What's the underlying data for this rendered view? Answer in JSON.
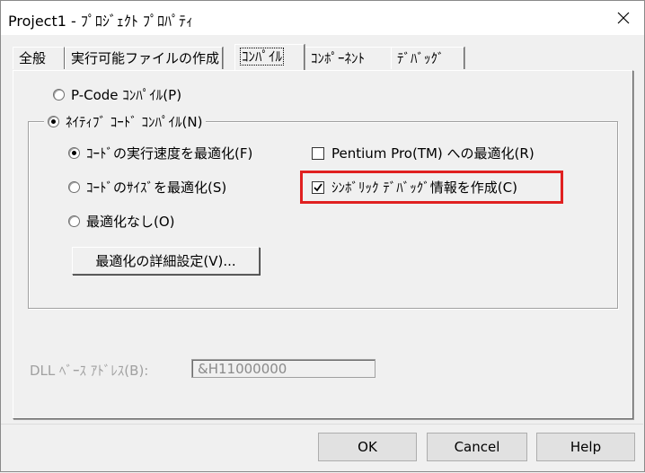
{
  "window": {
    "title": "Project1 - ﾌﾟﾛｼﾞｪｸﾄ ﾌﾟﾛﾊﾟﾃｨ",
    "close_icon": "close-icon"
  },
  "tabs": [
    {
      "label": "全般",
      "active": false
    },
    {
      "label": "実行可能ファイルの作成",
      "active": false
    },
    {
      "label": "ｺﾝﾊﾟｲﾙ",
      "active": true
    },
    {
      "label": "ｺﾝﾎﾟｰﾈﾝﾄ",
      "active": false
    },
    {
      "label": "ﾃﾞﾊﾞｯｸﾞ",
      "active": false
    }
  ],
  "compile": {
    "pcode_label": "P-Code ｺﾝﾊﾟｲﾙ(P)",
    "native_label": "ﾈｲﾃｨﾌﾞ ｺｰﾄﾞ ｺﾝﾊﾟｲﾙ(N)",
    "opt_speed_label": "ｺｰﾄﾞの実行速度を最適化(F)",
    "opt_size_label": "ｺｰﾄﾞのｻｲｽﾞを最適化(S)",
    "opt_none_label": "最適化なし(O)",
    "pentium_label": "Pentium Pro(TM) への最適化(R)",
    "symbolic_label": "ｼﾝﾎﾞﾘｯｸ ﾃﾞﾊﾞｯｸﾞ情報を作成(C)",
    "advanced_button": "最適化の詳細設定(V)...",
    "dll_label": "DLL ﾍﾞｰｽ ｱﾄﾞﾚｽ(B):",
    "dll_value": "&H11000000"
  },
  "buttons": {
    "ok": "OK",
    "cancel": "Cancel",
    "help": "Help"
  },
  "colors": {
    "highlight": "#e02020"
  }
}
